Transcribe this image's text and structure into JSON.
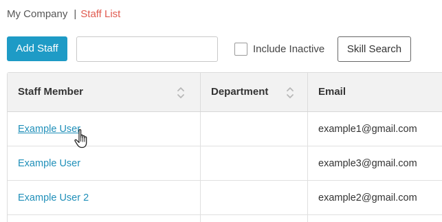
{
  "breadcrumb": {
    "home": "My Company",
    "separator": "|",
    "current": "Staff List"
  },
  "toolbar": {
    "add_staff_label": "Add Staff",
    "search_value": "",
    "include_inactive_label": "Include Inactive",
    "include_inactive_checked": false,
    "skill_search_label": "Skill Search"
  },
  "table": {
    "columns": [
      {
        "label": "Staff Member",
        "sortable": true
      },
      {
        "label": "Department",
        "sortable": true
      },
      {
        "label": "Email",
        "sortable": false
      }
    ],
    "rows": [
      {
        "name": "Example User",
        "department": "",
        "email": "example1@gmail.com"
      },
      {
        "name": "Example User",
        "department": "",
        "email": "example3@gmail.com"
      },
      {
        "name": "Example User 2",
        "department": "",
        "email": "example2@gmail.com"
      }
    ]
  },
  "colors": {
    "accent": "#1e9bc6",
    "link": "#1f8fb9",
    "breadcrumb_current": "#e05a4f",
    "header_bg": "#f2f2f2"
  },
  "icons": {
    "sort": "sort-icon",
    "cursor": "hand-pointer-icon"
  }
}
